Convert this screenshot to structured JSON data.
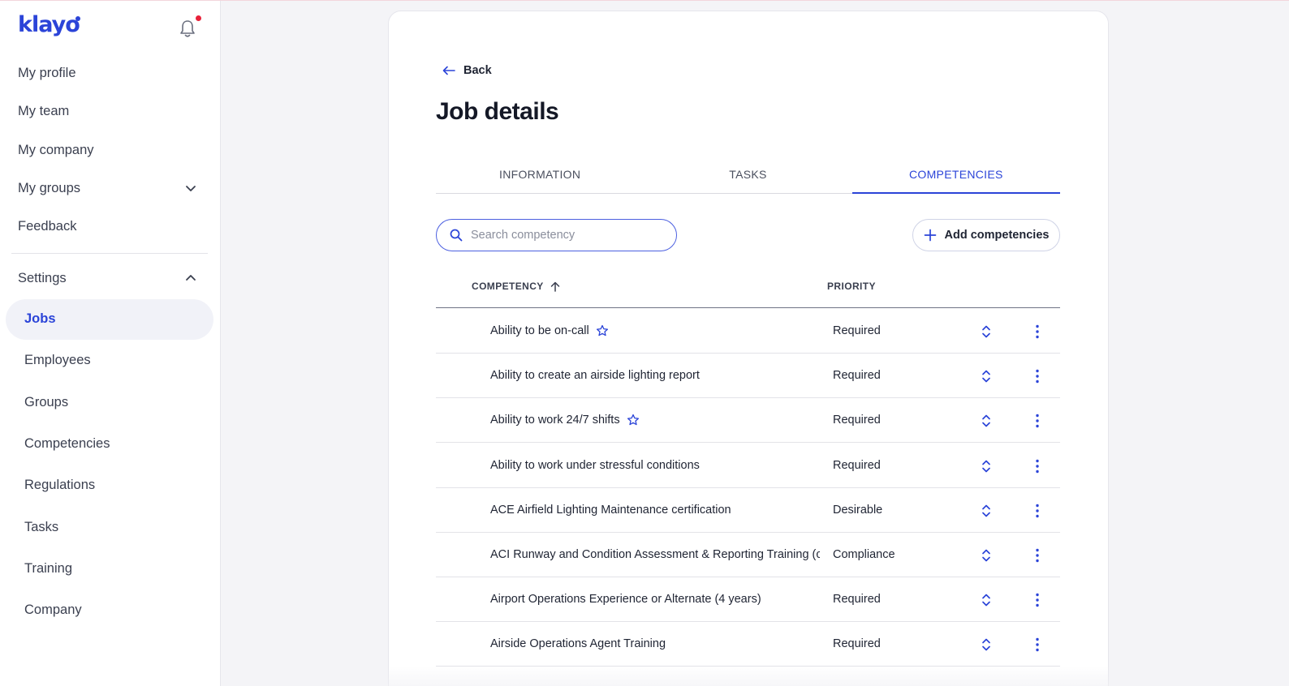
{
  "app": {
    "logo": "klayo"
  },
  "sidebar": {
    "nav": [
      {
        "label": "My profile"
      },
      {
        "label": "My team"
      },
      {
        "label": "My company"
      },
      {
        "label": "My groups"
      },
      {
        "label": "Feedback"
      }
    ],
    "settings_label": "Settings",
    "settings_items": [
      {
        "label": "Jobs",
        "active": true
      },
      {
        "label": "Employees"
      },
      {
        "label": "Groups"
      },
      {
        "label": "Competencies"
      },
      {
        "label": "Regulations"
      },
      {
        "label": "Tasks"
      },
      {
        "label": "Training"
      },
      {
        "label": "Company"
      }
    ]
  },
  "main": {
    "back_label": "Back",
    "title": "Job details",
    "tabs": [
      {
        "label": "INFORMATION"
      },
      {
        "label": "TASKS"
      },
      {
        "label": "COMPETENCIES",
        "active": true
      }
    ],
    "search_placeholder": "Search competency",
    "search_value": "",
    "add_button_label": "Add competencies",
    "table": {
      "columns": [
        "COMPETENCY",
        "PRIORITY"
      ],
      "rows": [
        {
          "competency": "Ability to be on-call",
          "priority": "Required",
          "starred": true
        },
        {
          "competency": "Ability to create an airside lighting report",
          "priority": "Required",
          "starred": false
        },
        {
          "competency": "Ability to work 24/7 shifts",
          "priority": "Required",
          "starred": true
        },
        {
          "competency": "Ability to work under stressful conditions",
          "priority": "Required",
          "starred": false
        },
        {
          "competency": "ACE Airfield Lighting Maintenance certification",
          "priority": "Desirable",
          "starred": false
        },
        {
          "competency": "ACI Runway and Condition Assessment & Reporting Training (c",
          "priority": "Compliance",
          "starred": false
        },
        {
          "competency": "Airport Operations Experience or Alternate (4 years)",
          "priority": "Required",
          "starred": false
        },
        {
          "competency": "Airside Operations Agent Training",
          "priority": "Required",
          "starred": false
        }
      ]
    }
  },
  "colors": {
    "accent": "#2b44d8",
    "notification": "#e8213a"
  }
}
